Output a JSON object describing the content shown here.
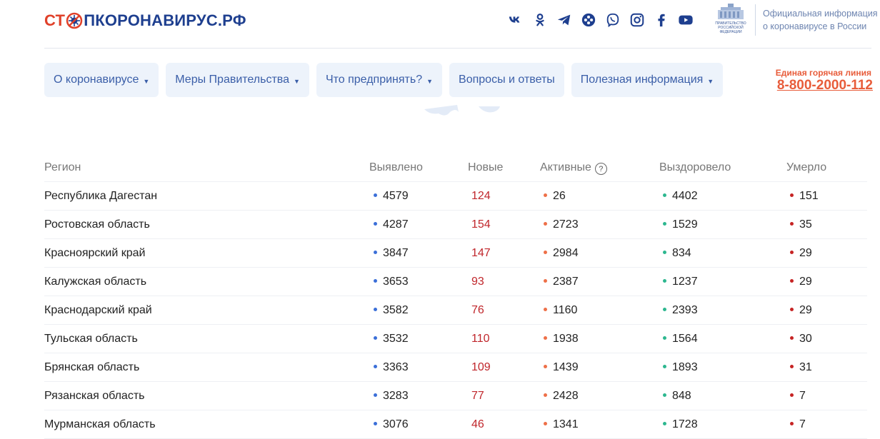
{
  "logo": {
    "part1": "СТ",
    "part2": "ПКОРОНАВИРУС.РФ"
  },
  "socials": [
    "vk-icon",
    "odnoklassniki-icon",
    "telegram-icon",
    "yandex-icon",
    "viber-icon",
    "instagram-icon",
    "facebook-icon",
    "youtube-icon"
  ],
  "gov": {
    "line1": "ПРАВИТЕЛЬСТВО",
    "line2": "РОССИЙСКОЙ",
    "line3": "ФЕДЕРАЦИИ"
  },
  "official": {
    "line1": "Официальная информация",
    "line2": "о коронавирусе в России"
  },
  "nav": [
    {
      "label": "О коронавирусе",
      "caret": "▼"
    },
    {
      "label": "Меры Правительства",
      "caret": "▼"
    },
    {
      "label": "Что предпринять?",
      "caret": "▼"
    },
    {
      "label": "Вопросы и ответы",
      "caret": ""
    },
    {
      "label": "Полезная информация",
      "caret": "▼"
    }
  ],
  "hotline": {
    "label": "Единая горячая линия",
    "phone": "8-800-2000-112"
  },
  "table": {
    "headers": {
      "region": "Регион",
      "found": "Выявлено",
      "new": "Новые",
      "active": "Активные",
      "active_help": "?",
      "recovered": "Выздоровело",
      "died": "Умерло"
    },
    "rows": [
      {
        "region": "Республика Дагестан",
        "found": "4579",
        "new": "124",
        "active": "26",
        "recovered": "4402",
        "died": "151"
      },
      {
        "region": "Ростовская область",
        "found": "4287",
        "new": "154",
        "active": "2723",
        "recovered": "1529",
        "died": "35"
      },
      {
        "region": "Красноярский край",
        "found": "3847",
        "new": "147",
        "active": "2984",
        "recovered": "834",
        "died": "29"
      },
      {
        "region": "Калужская область",
        "found": "3653",
        "new": "93",
        "active": "2387",
        "recovered": "1237",
        "died": "29"
      },
      {
        "region": "Краснодарский край",
        "found": "3582",
        "new": "76",
        "active": "1160",
        "recovered": "2393",
        "died": "29"
      },
      {
        "region": "Тульская область",
        "found": "3532",
        "new": "110",
        "active": "1938",
        "recovered": "1564",
        "died": "30"
      },
      {
        "region": "Брянская область",
        "found": "3363",
        "new": "109",
        "active": "1439",
        "recovered": "1893",
        "died": "31"
      },
      {
        "region": "Рязанская область",
        "found": "3283",
        "new": "77",
        "active": "2428",
        "recovered": "848",
        "died": "7"
      },
      {
        "region": "Мурманская область",
        "found": "3076",
        "new": "46",
        "active": "1341",
        "recovered": "1728",
        "died": "7"
      }
    ]
  },
  "colors": {
    "brand_red": "#e0412a",
    "brand_blue": "#1e3f8f",
    "nav_bg": "#edf3fb",
    "nav_text": "#3a5ea8",
    "hotline": "#e85c3a",
    "found_dot": "#3b6fd8",
    "active_dot": "#ee7048",
    "recovered_dot": "#2db78f",
    "died_dot": "#c62424",
    "new_text": "#c0262b"
  }
}
